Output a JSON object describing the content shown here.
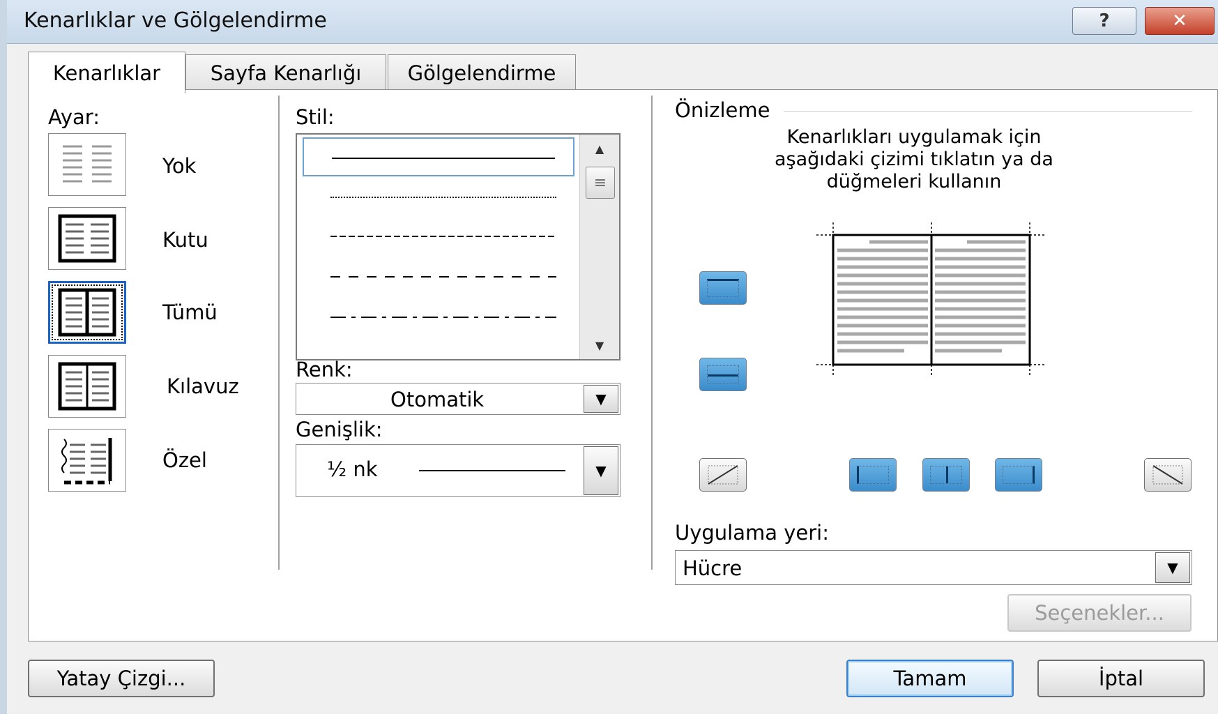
{
  "window": {
    "title": "Kenarlıklar ve Gölgelendirme",
    "help_label": "?",
    "close_label": "✕"
  },
  "tabs": [
    {
      "label": "Kenarlıklar",
      "active": true
    },
    {
      "label": "Sayfa Kenarlığı",
      "active": false
    },
    {
      "label": "Gölgelendirme",
      "active": false
    }
  ],
  "setting": {
    "label": "Ayar:",
    "options": [
      {
        "label": "Yok",
        "icon": "no-border-icon"
      },
      {
        "label": "Kutu",
        "icon": "box-border-icon"
      },
      {
        "label": "Tümü",
        "icon": "all-borders-icon",
        "selected": true
      },
      {
        "label": "Kılavuz",
        "icon": "grid-border-icon"
      },
      {
        "label": "Özel",
        "icon": "custom-border-icon"
      }
    ]
  },
  "style": {
    "label": "Stil:"
  },
  "color": {
    "label": "Renk:",
    "value": "Otomatik"
  },
  "width": {
    "label": "Genişlik:",
    "value": "½ nk"
  },
  "preview": {
    "label": "Önizleme",
    "instructions_line1": "Kenarlıkları uygulamak için",
    "instructions_line2": "aşağıdaki çizimi tıklatın ya da",
    "instructions_line3": "düğmeleri kullanın"
  },
  "apply_to": {
    "label": "Uygulama yeri:",
    "value": "Hücre"
  },
  "buttons": {
    "options": "Seçenekler...",
    "horizontal_line": "Yatay Çizgi...",
    "ok": "Tamam",
    "cancel": "İptal"
  },
  "colors": {
    "accent": "#3b8ccc",
    "selection": "#1a63c8",
    "close": "#c4402a"
  }
}
